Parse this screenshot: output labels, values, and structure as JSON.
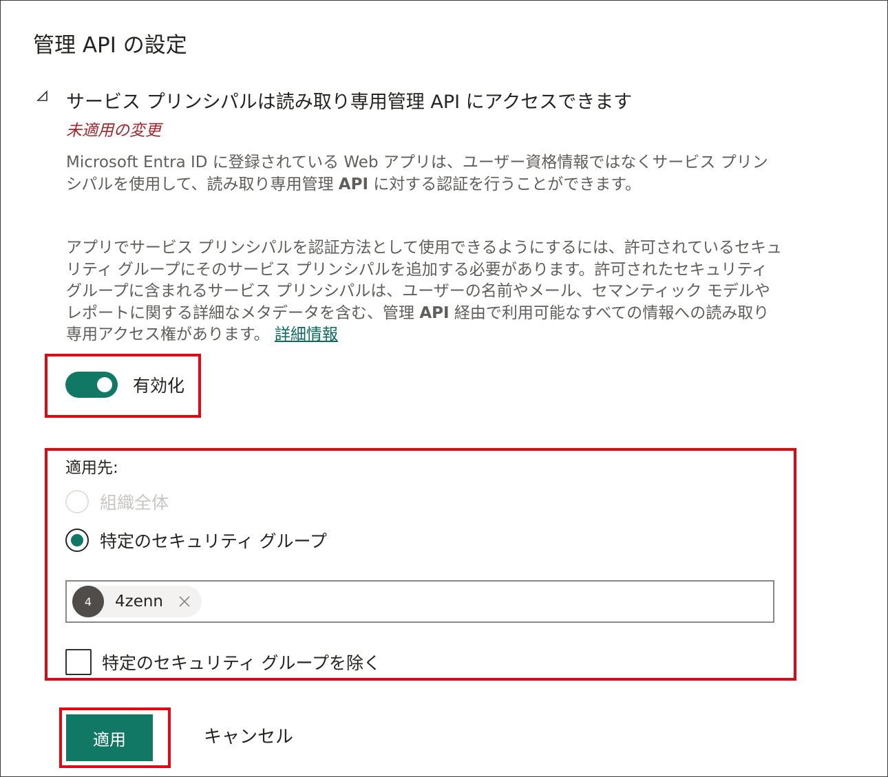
{
  "page_title": "管理 API の設定",
  "section": {
    "title": "サービス プリンシパルは読み取り専用管理 API にアクセスできます",
    "status": "未適用の変更",
    "desc1_a": "Microsoft Entra ID に登録されている Web アプリは、ユーザー資格情報ではなくサービス プリンシパルを使用して、読み取り専用管理 ",
    "desc1_b": "API",
    "desc1_c": " に対する認証を行うことができます。",
    "desc2_a": "アプリでサービス プリンシパルを認証方法として使用できるようにするには、許可されているセキュリティ グループにそのサービス プリンシパルを追加する必要があります。許可されたセキュリティ グループに含まれるサービス プリンシパルは、ユーザーの名前やメール、セマンティック モデルやレポートに関する詳細なメタデータを含む、管理 ",
    "desc2_b": "API",
    "desc2_c": " 経由で利用可能なすべての情報への読み取り専用アクセス権があります。 ",
    "learn_more": "詳細情報"
  },
  "toggle": {
    "label": "有効化",
    "on": true
  },
  "applies_to": {
    "label": "適用先:",
    "options": [
      {
        "label": "組織全体",
        "selected": false,
        "disabled": true
      },
      {
        "label": "特定のセキュリティ グループ",
        "selected": true,
        "disabled": false
      }
    ]
  },
  "group_picker": {
    "chips": [
      {
        "initial": "4",
        "name": "4zenn"
      }
    ]
  },
  "exclude": {
    "label": "特定のセキュリティ グループを除く",
    "checked": false
  },
  "buttons": {
    "apply": "適用",
    "cancel": "キャンセル"
  },
  "colors": {
    "accent": "#117865",
    "warning": "#a4262c",
    "link": "#0b6a5e",
    "highlight_box": "#e30613"
  },
  "icons": {
    "section_toggle": "triangle-collapse-icon",
    "chip_remove": "close-icon"
  }
}
